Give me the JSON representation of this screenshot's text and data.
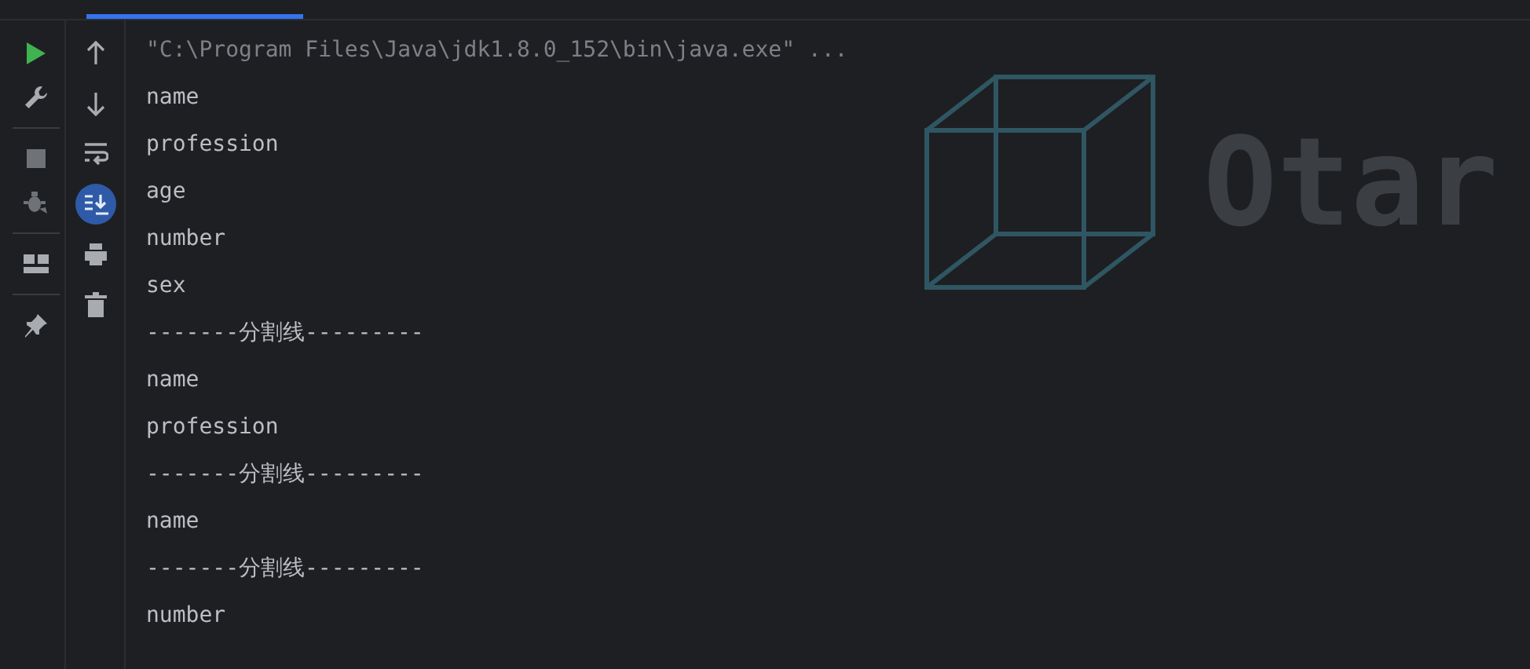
{
  "tabs": [
    {
      "selected": true
    }
  ],
  "left_toolbar": [
    {
      "kind": "run"
    },
    {
      "kind": "wrench"
    },
    {
      "kind": "separator"
    },
    {
      "kind": "stop"
    },
    {
      "kind": "bug"
    },
    {
      "kind": "separator"
    },
    {
      "kind": "layout"
    },
    {
      "kind": "separator"
    },
    {
      "kind": "pin"
    }
  ],
  "console_toolbar": [
    {
      "kind": "up",
      "selected": false
    },
    {
      "kind": "down",
      "selected": false
    },
    {
      "kind": "wrap",
      "selected": false
    },
    {
      "kind": "scroll_end",
      "selected": true
    },
    {
      "kind": "print",
      "selected": false
    },
    {
      "kind": "trash",
      "selected": false
    }
  ],
  "console_lines": [
    {
      "kind": "command",
      "text": "\"C:\\Program Files\\Java\\jdk1.8.0_152\\bin\\java.exe\" ..."
    },
    {
      "kind": "output",
      "text": "name"
    },
    {
      "kind": "output",
      "text": "profession"
    },
    {
      "kind": "output",
      "text": "age"
    },
    {
      "kind": "output",
      "text": "number"
    },
    {
      "kind": "output",
      "text": "sex"
    },
    {
      "kind": "output",
      "text": "-------分割线---------"
    },
    {
      "kind": "output",
      "text": "name"
    },
    {
      "kind": "output",
      "text": "profession"
    },
    {
      "kind": "output",
      "text": "-------分割线---------"
    },
    {
      "kind": "output",
      "text": "name"
    },
    {
      "kind": "output",
      "text": "-------分割线---------"
    },
    {
      "kind": "output",
      "text": "number"
    }
  ],
  "background_logo": {
    "text": "Otar"
  }
}
